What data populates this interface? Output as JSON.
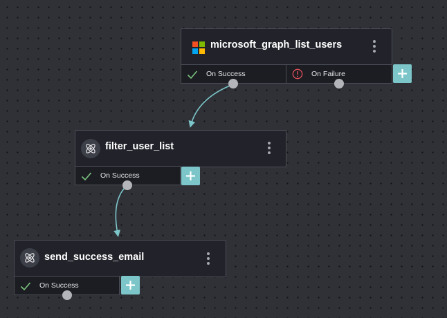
{
  "workflow": {
    "nodes": [
      {
        "id": "microsoft_graph_list_users",
        "title": "microsoft_graph_list_users",
        "icon": "microsoft-logo-icon",
        "branches": [
          {
            "label": "On Success",
            "icon": "checkmark-icon",
            "color": "#7bc47f"
          },
          {
            "label": "On Failure",
            "icon": "alert-circle-icon",
            "color": "#e0505a"
          }
        ]
      },
      {
        "id": "filter_user_list",
        "title": "filter_user_list",
        "icon": "atom-icon",
        "branches": [
          {
            "label": "On Success",
            "icon": "checkmark-icon",
            "color": "#7bc47f"
          }
        ]
      },
      {
        "id": "send_success_email",
        "title": "send_success_email",
        "icon": "atom-icon",
        "branches": [
          {
            "label": "On Success",
            "icon": "checkmark-icon",
            "color": "#7bc47f"
          }
        ]
      }
    ],
    "connections": [
      {
        "from": "microsoft_graph_list_users",
        "branch": "On Success",
        "to": "filter_user_list"
      },
      {
        "from": "filter_user_list",
        "branch": "On Success",
        "to": "send_success_email"
      }
    ]
  },
  "colors": {
    "canvas": "#2f3137",
    "node_bg": "#22232a",
    "accent": "#7cc6c9",
    "success": "#7bc47f",
    "failure": "#e0505a",
    "port": "#b3b5ba",
    "connector": "#7cc6c9"
  }
}
